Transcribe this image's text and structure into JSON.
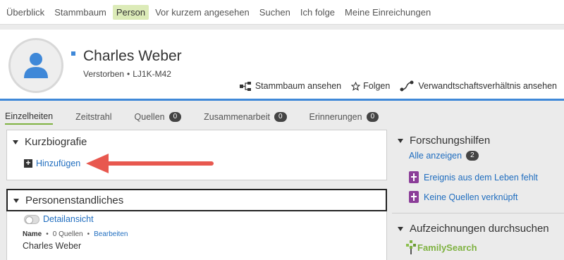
{
  "topnav": {
    "items": [
      "Überblick",
      "Stammbaum",
      "Person",
      "Vor kurzem angesehen",
      "Suchen",
      "Ich folge",
      "Meine Einreichungen"
    ],
    "active_index": 2
  },
  "person": {
    "name": "Charles Weber",
    "status": "Verstorben",
    "pid": "LJ1K-M42",
    "sex_color": "#3f88d8"
  },
  "actions": {
    "tree": "Stammbaum ansehen",
    "follow": "Folgen",
    "relationship": "Verwandtschaftsverhältnis ansehen"
  },
  "subtabs": {
    "details": "Einzelheiten",
    "timeline": "Zeitstrahl",
    "sources": {
      "label": "Quellen",
      "count": "0"
    },
    "collab": {
      "label": "Zusammenarbeit",
      "count": "0"
    },
    "memories": {
      "label": "Erinnerungen",
      "count": "0"
    }
  },
  "bio": {
    "title": "Kurzbiografie",
    "add_label": "Hinzufügen"
  },
  "vitals": {
    "title": "Personenstandliches",
    "toggle_label": "Detailansicht",
    "name_label": "Name",
    "sources_text": "0 Quellen",
    "edit_label": "Bearbeiten",
    "name_value": "Charles Weber"
  },
  "research": {
    "title": "Forschungshilfen",
    "show_all": "Alle anzeigen",
    "count": "2",
    "hints": [
      "Ereignis aus dem Leben fehlt",
      "Keine Quellen verknüpft"
    ]
  },
  "records": {
    "title": "Aufzeichnungen durchsuchen",
    "logo_text": "FamilySearch"
  },
  "colors": {
    "accent_blue": "#3f88d8",
    "link": "#1f6dbf",
    "active_green": "#7fb241",
    "hint_purple": "#8b3d98",
    "annotation_red": "#e8584f"
  }
}
